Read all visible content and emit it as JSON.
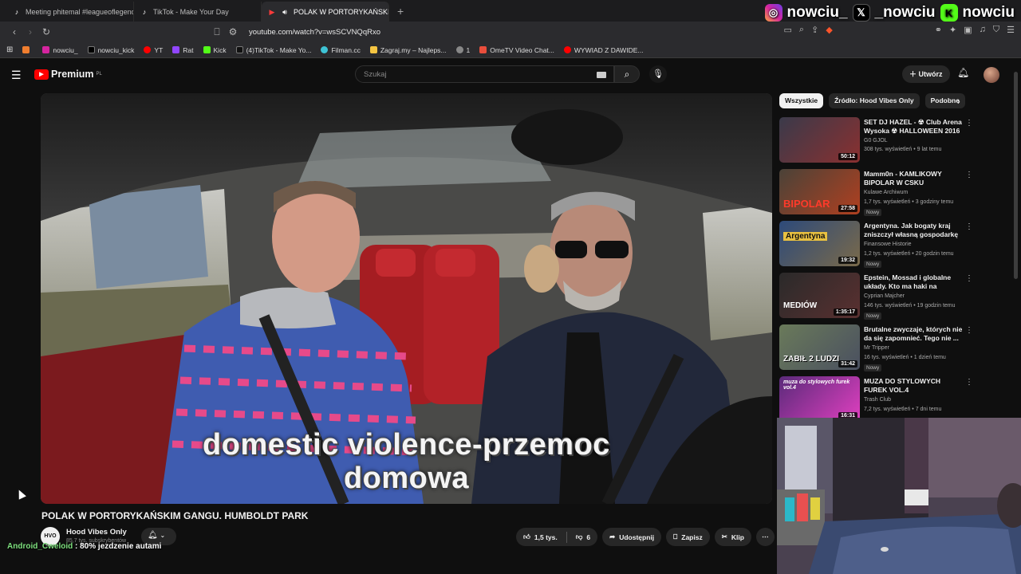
{
  "browser": {
    "tabs": [
      {
        "label": "Meeting phitemal #leagueoflegends",
        "active": false
      },
      {
        "label": "TikTok - Make Your Day",
        "active": false
      },
      {
        "label": "POLAK W PORTORYKAŃSKIM",
        "active": true
      }
    ],
    "url": "youtube.com/watch?v=wsSCVNQqRxo",
    "bookmarks": [
      {
        "label": "",
        "color": "#f07e2f"
      },
      {
        "label": "nowciu_",
        "color": "#d6249f"
      },
      {
        "label": "nowciu_kick",
        "color": "#000000"
      },
      {
        "label": "YT",
        "color": "#ff0000"
      },
      {
        "label": "Rat",
        "color": "#9146ff"
      },
      {
        "label": "Kick",
        "color": "#53fc18"
      },
      {
        "label": "(4)TikTok - Make Yo...",
        "color": "#111111"
      },
      {
        "label": "Filman.cc",
        "color": "#3ec3d5"
      },
      {
        "label": "Zagraj.my – Najleps...",
        "color": "#f5c542"
      },
      {
        "label": "1",
        "color": "#888888"
      },
      {
        "label": "OmeTV Video Chat...",
        "color": "#e94e3c"
      },
      {
        "label": "WYWIAD Z DAWIDE...",
        "color": "#ff0000"
      }
    ]
  },
  "social": {
    "instagram": "nowciu_",
    "x": "_nowciu",
    "kick": "nowciu"
  },
  "youtube": {
    "logo_label": "Premium",
    "logo_region": "PL",
    "search_placeholder": "Szukaj",
    "create_label": "Utwórz"
  },
  "video": {
    "caption_line1": "domestic violence-przemoc",
    "caption_line2": "domowa",
    "title": "POLAK W PORTORYKAŃSKIM GANGU. HUMBOLDT PARK",
    "channel": "Hood Vibes Only",
    "subscribers": "85,7 tys. subskrybentów",
    "channel_avatar_text": "HVO",
    "likes": "1,5 tys.",
    "dislikes": "6",
    "share_label": "Udostępnij",
    "save_label": "Zapisz",
    "clip_label": "Klip"
  },
  "chat": {
    "user": "Android_Cweloid",
    "message": ": 80% jezdzenie autami"
  },
  "chips": [
    "Wszystkie",
    "Źródło: Hood Vibes Only",
    "Podobne"
  ],
  "recommendations": [
    {
      "title": "SET DJ HAZEL - ☢ Club Arena Wysoka ☢ HALLOWEEN 2016 ...",
      "channel": "G0 GJOL",
      "meta": "308 tys. wyświetleń • 9 lat temu",
      "duration": "50:12",
      "badge": "",
      "thumb_text": "",
      "colors": [
        "#3a3a4a",
        "#8a3030"
      ]
    },
    {
      "title": "Mamm0n - KAMLIKOWY BIPOLAR W CSKU",
      "channel": "Kulawe Archiwum",
      "meta": "1,7 tys. wyświetleń • 3 godziny temu",
      "duration": "27:58",
      "badge": "Nowy",
      "thumb_text": "BIPOLAR",
      "colors": [
        "#4a4238",
        "#b04020"
      ]
    },
    {
      "title": "Argentyna. Jak bogaty kraj zniszczył własną gospodarkę",
      "channel": "Finansowe Historie",
      "meta": "1,2 tys. wyświetleń • 20 godzin temu",
      "duration": "19:32",
      "badge": "Nowy",
      "thumb_text": "Argentyna",
      "colors": [
        "#2d4a7a",
        "#e8c040"
      ]
    },
    {
      "title": "Epstein, Mossad i globalne układy. Kto ma haki na polskie...",
      "channel": "Cyprian Majcher",
      "meta": "146 tys. wyświetleń • 19 godzin temu",
      "duration": "1:35:17",
      "badge": "Nowy",
      "thumb_text": "MEDIÓW",
      "colors": [
        "#2a2a2a",
        "#c02020"
      ]
    },
    {
      "title": "Brutalne zwyczaje, których nie da się zapomnieć. Tego nie ...",
      "channel": "Mr Tripper",
      "meta": "16 tys. wyświetleń • 1 dzień temu",
      "duration": "31:42",
      "badge": "Nowy",
      "thumb_text": "ZABIŁ 2 LUDZI",
      "colors": [
        "#6a7a5a",
        "#d8d040"
      ]
    },
    {
      "title": "MUZA DO STYLOWYCH FUREK VOL.4",
      "channel": "Trash Club",
      "meta": "7,2 tys. wyświetleń • 7 dni temu",
      "duration": "16:31",
      "badge": "",
      "thumb_text": "muza do stylowych furek vol.4",
      "colors": [
        "#5a2a7a",
        "#e040c0"
      ]
    }
  ]
}
